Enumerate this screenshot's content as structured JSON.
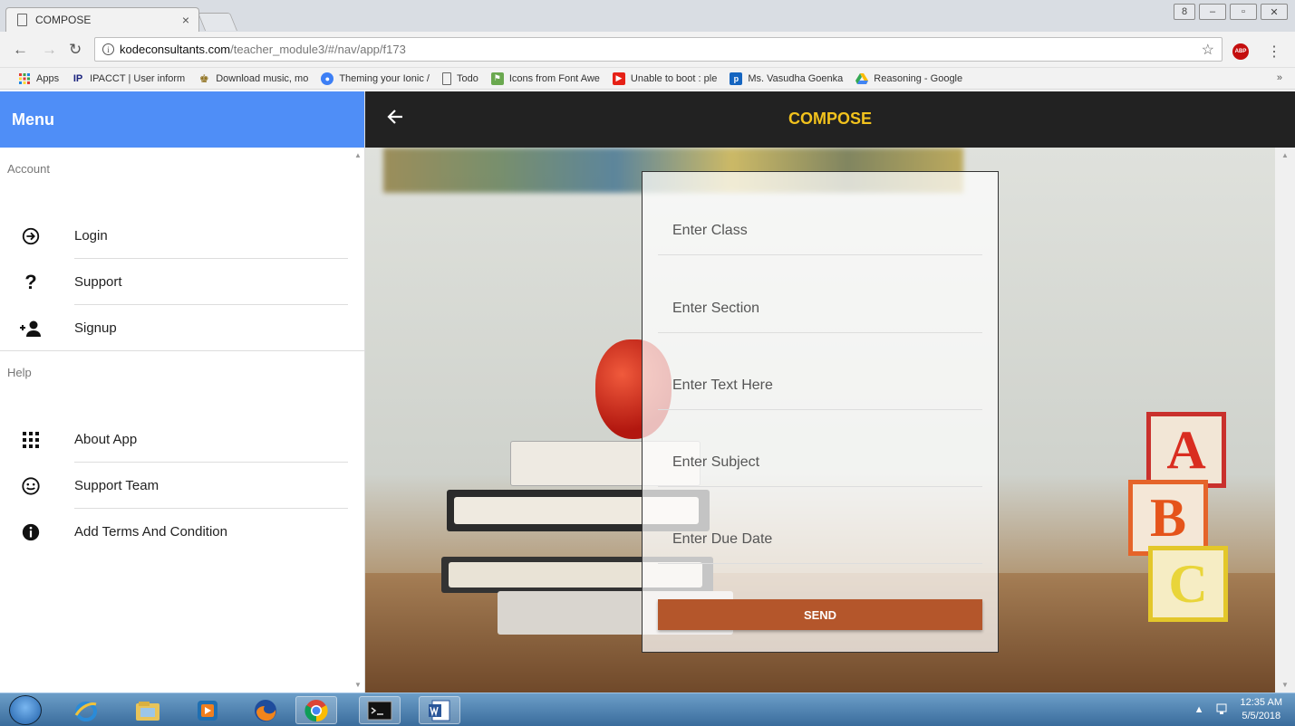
{
  "browser": {
    "tab_title": "COMPOSE",
    "tab_close": "×",
    "url_host": "kodeconsultants.com",
    "url_path": "/teacher_module3/#/nav/app/f173",
    "abp_label": "ABP",
    "bookmarks": [
      {
        "label": "Apps",
        "icon": "apps-grid-icon"
      },
      {
        "label": "IPACCT | User inform",
        "icon": "ipacct-icon"
      },
      {
        "label": "Download music, mo",
        "icon": "music-icon"
      },
      {
        "label": "Theming your Ionic /",
        "icon": "ionic-icon"
      },
      {
        "label": "Todo",
        "icon": "doc-icon"
      },
      {
        "label": "Icons from Font Awe",
        "icon": "fontawesome-icon"
      },
      {
        "label": "Unable to boot : ple",
        "icon": "youtube-icon"
      },
      {
        "label": "Ms. Vasudha Goenka",
        "icon": "p-icon"
      },
      {
        "label": "Reasoning - Google",
        "icon": "google-drive-icon"
      }
    ],
    "bookmarks_more": "»"
  },
  "sidebar": {
    "title": "Menu",
    "sections": [
      {
        "label": "Account",
        "items": [
          {
            "label": "Login",
            "icon": "login-icon"
          },
          {
            "label": "Support",
            "icon": "question-icon"
          },
          {
            "label": "Signup",
            "icon": "add-person-icon"
          }
        ]
      },
      {
        "label": "Help",
        "items": [
          {
            "label": "About App",
            "icon": "grid-icon"
          },
          {
            "label": "Support Team",
            "icon": "smiley-icon"
          },
          {
            "label": "Add Terms And Condition",
            "icon": "info-icon"
          }
        ]
      }
    ]
  },
  "header": {
    "title": "COMPOSE",
    "back_icon": "arrow-left-icon"
  },
  "form": {
    "fields": [
      {
        "placeholder": "Enter Class",
        "value": ""
      },
      {
        "placeholder": "Enter Section",
        "value": ""
      },
      {
        "placeholder": "Enter Text Here",
        "value": ""
      },
      {
        "placeholder": "Enter Subject",
        "value": ""
      },
      {
        "placeholder": "Enter Due Date",
        "value": ""
      }
    ],
    "send_label": "SEND"
  },
  "taskbar": {
    "time": "12:35 AM",
    "date": "5/5/2018"
  },
  "colors": {
    "menu_header": "#4f8ef7",
    "topbar": "#222222",
    "title": "#f2c21d",
    "send_button": "#b4562b"
  }
}
